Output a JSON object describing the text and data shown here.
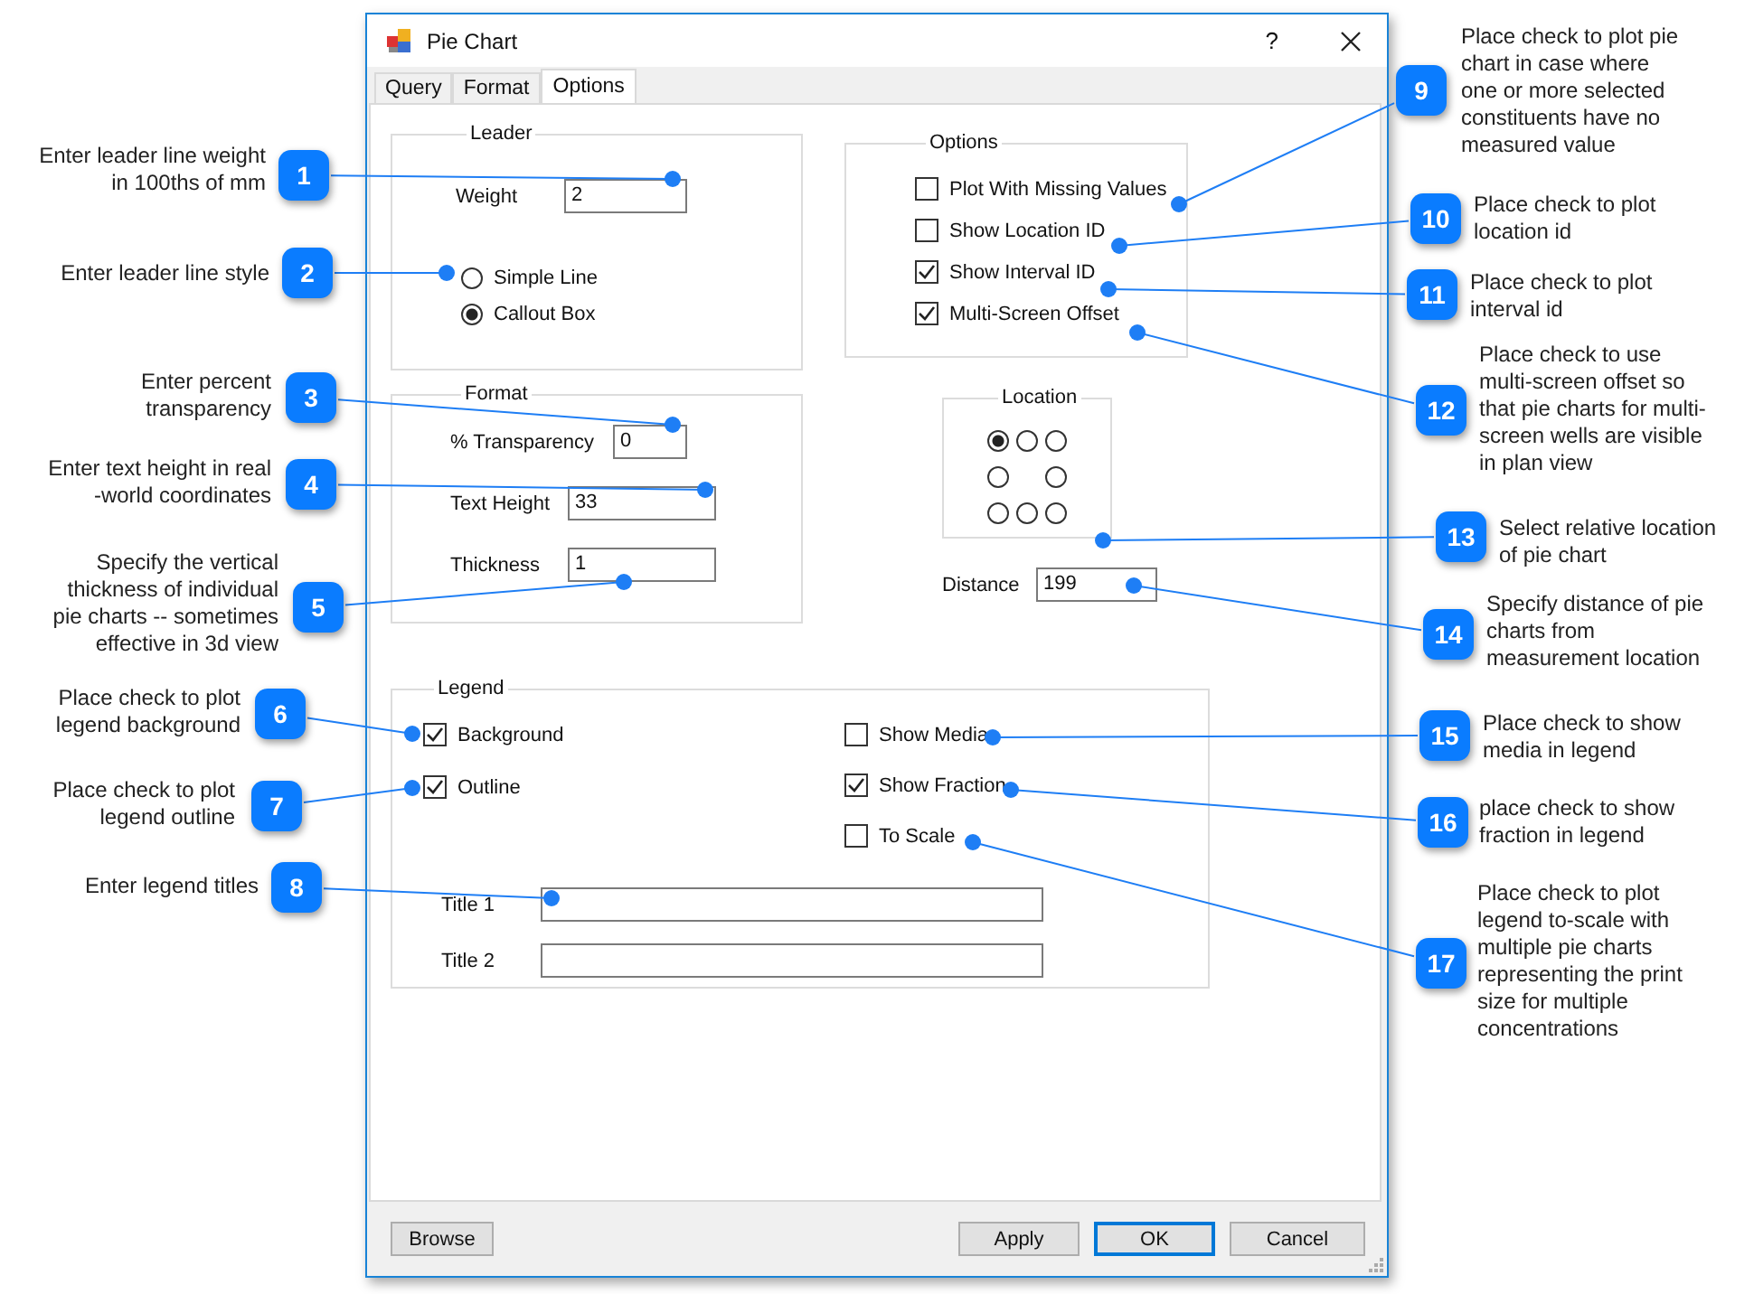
{
  "window": {
    "title": "Pie Chart",
    "help": "?"
  },
  "tabs": [
    {
      "label": "Query",
      "selected": false
    },
    {
      "label": "Format",
      "selected": false
    },
    {
      "label": "Options",
      "selected": true
    }
  ],
  "leader": {
    "title": "Leader",
    "weight": {
      "label": "Weight",
      "value": "2"
    },
    "styles": [
      {
        "label": "Simple Line",
        "selected": false
      },
      {
        "label": "Callout Box",
        "selected": true
      }
    ]
  },
  "options": {
    "title": "Options",
    "items": [
      {
        "label": "Plot With Missing Values",
        "checked": false
      },
      {
        "label": "Show Location ID",
        "checked": false
      },
      {
        "label": "Show Interval ID",
        "checked": true
      },
      {
        "label": "Multi-Screen Offset",
        "checked": true
      }
    ]
  },
  "format": {
    "title": "Format",
    "fields": [
      {
        "label": "% Transparency",
        "value": "0"
      },
      {
        "label": "Text Height",
        "value": "33"
      },
      {
        "label": "Thickness",
        "value": "1"
      }
    ]
  },
  "location": {
    "title": "Location",
    "positions": [
      {
        "selected": true
      },
      {
        "selected": false
      },
      {
        "selected": false
      },
      {
        "selected": false
      },
      {
        "selected": false
      },
      {
        "selected": false
      },
      {
        "selected": false
      },
      {
        "selected": false
      }
    ]
  },
  "distance": {
    "label": "Distance",
    "value": "199"
  },
  "legend": {
    "title": "Legend",
    "left_items": [
      {
        "label": "Background",
        "checked": true
      },
      {
        "label": "Outline",
        "checked": true
      }
    ],
    "right_items": [
      {
        "label": "Show Media",
        "checked": false
      },
      {
        "label": "Show Fraction",
        "checked": true
      },
      {
        "label": "To Scale",
        "checked": false
      }
    ],
    "titles": [
      {
        "label": "Title 1"
      },
      {
        "label": "Title 2"
      }
    ]
  },
  "buttons": [
    {
      "label": "Browse",
      "default": false
    },
    {
      "label": "Apply",
      "default": false
    },
    {
      "label": "OK",
      "default": true
    },
    {
      "label": "Cancel",
      "default": false
    }
  ],
  "callouts": [
    {
      "number": "1",
      "text": "Enter leader line weight\nin 100ths of mm"
    },
    {
      "number": "2",
      "text": "Enter leader line style"
    },
    {
      "number": "3",
      "text": "Enter percent\ntransparency"
    },
    {
      "number": "4",
      "text": "Enter text height in real\n-world coordinates"
    },
    {
      "number": "5",
      "text": "Specify the vertical\nthickness of individual\npie charts -- sometimes\neffective in 3d view"
    },
    {
      "number": "6",
      "text": "Place check to plot\nlegend background"
    },
    {
      "number": "7",
      "text": "Place check to plot\nlegend outline"
    },
    {
      "number": "8",
      "text": "Enter legend titles"
    },
    {
      "number": "9",
      "text": "Place check to plot pie\nchart in case where\none or more selected\nconstituents have no\nmeasured value"
    },
    {
      "number": "10",
      "text": "Place check to plot\nlocation id"
    },
    {
      "number": "11",
      "text": "Place check to plot\ninterval id"
    },
    {
      "number": "12",
      "text": "Place check to use\nmulti-screen offset so\nthat pie charts for multi-\nscreen wells are visible\nin plan view"
    },
    {
      "number": "13",
      "text": "Select relative location\nof pie chart"
    },
    {
      "number": "14",
      "text": "Specify distance of pie\ncharts from\nmeasurement location"
    },
    {
      "number": "15",
      "text": "Place check to show\nmedia in legend"
    },
    {
      "number": "16",
      "text": "place check to show\nfraction in legend"
    },
    {
      "number": "17",
      "text": "Place check to plot\nlegend to-scale with\nmultiple pie charts\nrepresenting the print\nsize for multiple\nconcentrations"
    }
  ]
}
